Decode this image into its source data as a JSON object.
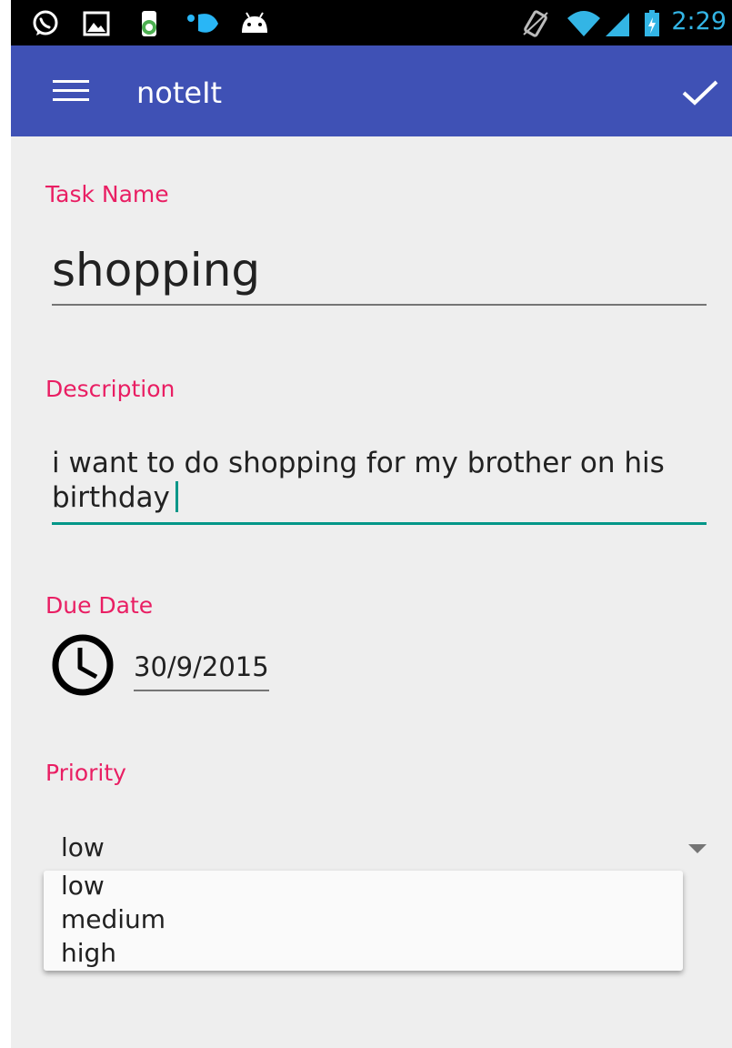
{
  "status_bar": {
    "time": "2:29",
    "left_icons": [
      "whatsapp-icon",
      "gallery-icon",
      "app-icon",
      "bird-icon",
      "android-icon"
    ],
    "right_icons": [
      "vibrate-icon",
      "wifi-icon",
      "signal-icon",
      "battery-charging-icon"
    ]
  },
  "app_bar": {
    "title": "noteIt",
    "menu_icon": "menu-icon",
    "save_icon": "check-icon",
    "color": "#3f51b5"
  },
  "form": {
    "task_name": {
      "label": "Task Name",
      "value": "shopping"
    },
    "description": {
      "label": "Description",
      "value": "i want to do shopping for my brother on his birthday"
    },
    "due_date": {
      "label": "Due Date",
      "value": "30/9/2015",
      "icon": "clock-icon"
    },
    "priority": {
      "label": "Priority",
      "selected": "low",
      "options": [
        "low",
        "medium",
        "high"
      ]
    }
  },
  "colors": {
    "label": "#e91e63",
    "focus_underline": "#009688",
    "status_time": "#33b5e5"
  }
}
